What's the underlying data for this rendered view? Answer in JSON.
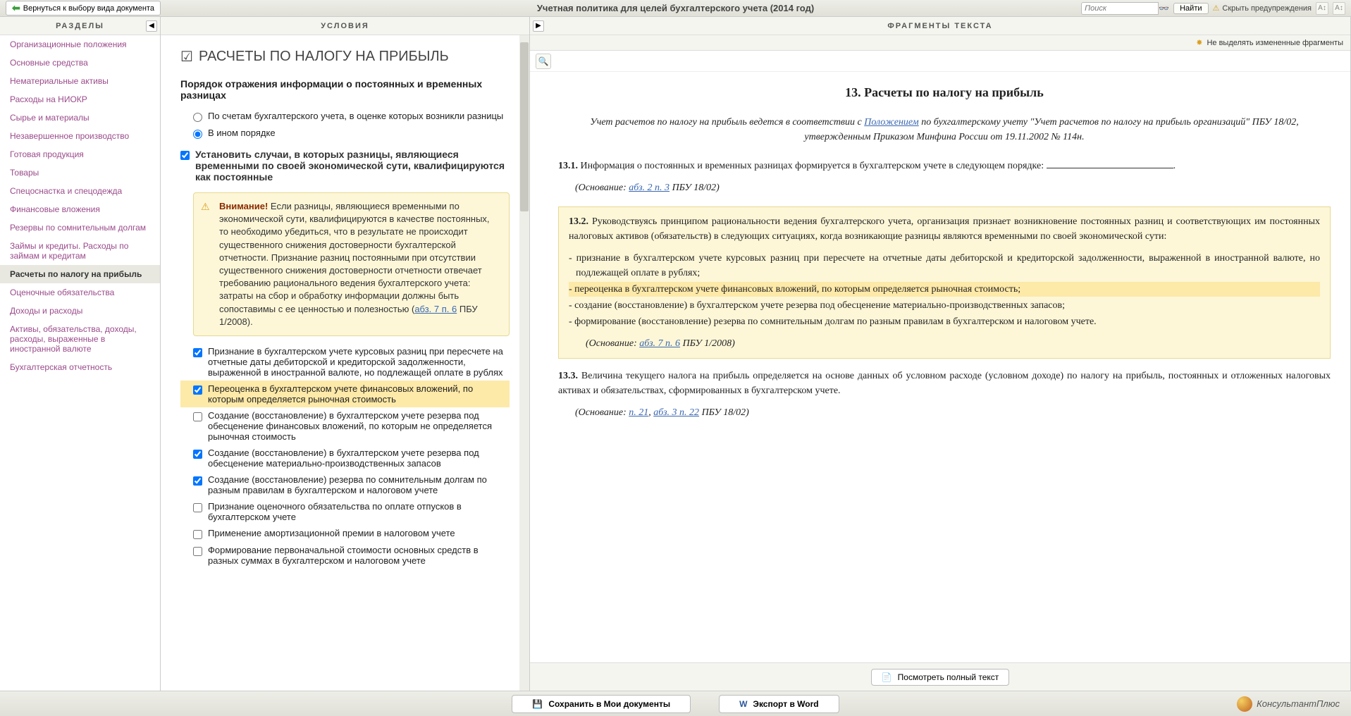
{
  "top": {
    "back": "Вернуться к выбору вида документа",
    "title": "Учетная политика для целей бухгалтерского учета (2014 год)",
    "search_placeholder": "Поиск",
    "find": "Найти",
    "hide_warnings": "Скрыть предупреждения",
    "fontsize1": "A↕",
    "fontsize2": "A↕"
  },
  "panels": {
    "sections": "РАЗДЕЛЫ",
    "conditions": "УСЛОВИЯ",
    "fragments": "ФРАГМЕНТЫ ТЕКСТА"
  },
  "sidebar": {
    "items": [
      "Организационные положения",
      "Основные средства",
      "Нематериальные активы",
      "Расходы на НИОКР",
      "Сырье и материалы",
      "Незавершенное производство",
      "Готовая продукция",
      "Товары",
      "Спецоснастка и спецодежда",
      "Финансовые вложения",
      "Резервы по сомнительным долгам",
      "Займы и кредиты. Расходы по займам и кредитам",
      "Расчеты по налогу на прибыль",
      "Оценочные обязательства",
      "Доходы и расходы",
      "Активы, обязательства, доходы, расходы, выраженные в иностранной валюте",
      "Бухгалтерская отчетность"
    ],
    "active_index": 12
  },
  "cond": {
    "section_title": "РАСЧЕТЫ ПО НАЛОГУ НА ПРИБЫЛЬ",
    "h1": "Порядок отражения информации о постоянных и временных разницах",
    "r1": "По счетам бухгалтерского учета, в оценке которых возникли разницы",
    "r2": "В ином порядке",
    "h2": "Установить случаи, в которых разницы, являющиеся временными по своей экономической сути, квалифицируются как постоянные",
    "warn_b": "Внимание!",
    "warn_text": " Если разницы, являющиеся временными по экономической сути, квалифицируются в качестве постоянных, то необходимо убедиться, что в результате не происходит существенного снижения достоверности бухгалтерской отчетности. Признание разниц постоянными при отсутствии существенного снижения достоверности отчетности отвечает требованию рационального ведения бухгалтерского учета: затраты на сбор и обработку информации должны быть сопоставимы с ее ценностью и полезностью (",
    "warn_link": "абз. 7 п. 6",
    "warn_tail": " ПБУ 1/2008).",
    "c1": "Признание в бухгалтерском учете курсовых разниц при пересчете на отчетные даты дебиторской и кредиторской задолженности, выраженной в иностранной валюте, но подлежащей оплате в рублях",
    "c2": "Переоценка в бухгалтерском учете финансовых вложений, по которым определяется рыночная стоимость",
    "c3": "Создание (восстановление) в бухгалтерском учете резерва под обесценение финансовых вложений, по которым не определяется рыночная стоимость",
    "c4": "Создание (восстановление) в бухгалтерском учете резерва под обесценение материально-производственных запасов",
    "c5": "Создание (восстановление) резерва по сомнительным долгам по разным правилам в бухгалтерском и налоговом учете",
    "c6": "Признание оценочного обязательства по оплате отпусков в бухгалтерском учете",
    "c7": "Применение амортизационной премии в налоговом учете",
    "c8": "Формирование первоначальной стоимости основных средств в разных суммах в бухгалтерском и налоговом учете"
  },
  "frag": {
    "no_highlight": "Не выделять измененные фрагменты",
    "h": "13. Расчеты по налогу на прибыль",
    "intro1": "Учет расчетов по налогу на прибыль ведется в соответствии с ",
    "intro_link": "Положением",
    "intro2": " по бухгалтерскому учету \"Учет расчетов по налогу на прибыль организаций\" ПБУ 18/02, утвержденным Приказом Минфина России от 19.11.2002 № 114н.",
    "p131_b": "13.1.",
    "p131": " Информация о постоянных и временных разницах формируется в бухгалтерском учете в следующем порядке: ",
    "basis_label": "(Основание: ",
    "basis131_link": "абз. 2 п. 3",
    "basis131_tail": " ПБУ 18/02)",
    "p132_b": "13.2.",
    "p132": " Руководствуясь принципом рациональности ведения бухгалтерского учета, организация признает возникновение постоянных разниц и соответствующих им постоянных налоговых активов (обязательств) в следующих ситуациях, когда возникающие разницы являются временными по своей экономической сути:",
    "li1": "- признание в бухгалтерском учете курсовых разниц при пересчете на отчетные даты дебиторской и кредиторской задолженности, выраженной в иностранной валюте, но подлежащей оплате в рублях;",
    "li2": "- переоценка в бухгалтерском учете финансовых вложений, по которым определяется рыночная стоимость;",
    "li3": "- создание (восстановление) в бухгалтерском учете резерва под обесценение материально-производственных запасов;",
    "li4": "- формирование (восстановление) резерва по сомнительным долгам по разным правилам в бухгалтерском и налоговом учете.",
    "basis132_link": "абз. 7 п. 6",
    "basis132_tail": " ПБУ 1/2008)",
    "p133_b": "13.3.",
    "p133": " Величина текущего налога на прибыль определяется на основе данных об условном расходе (условном доходе) по налогу на прибыль, постоянных и отложенных налоговых активах и обязательствах, сформированных в бухгалтерском учете.",
    "basis133_l1": "п. 21",
    "basis133_sep": ", ",
    "basis133_l2": "абз. 3 п. 22",
    "basis133_tail": " ПБУ 18/02)",
    "view_full": "Посмотреть полный текст"
  },
  "bottom": {
    "save": "Сохранить в Мои документы",
    "export": "Экспорт в Word",
    "brand": "КонсультантПлюс"
  }
}
